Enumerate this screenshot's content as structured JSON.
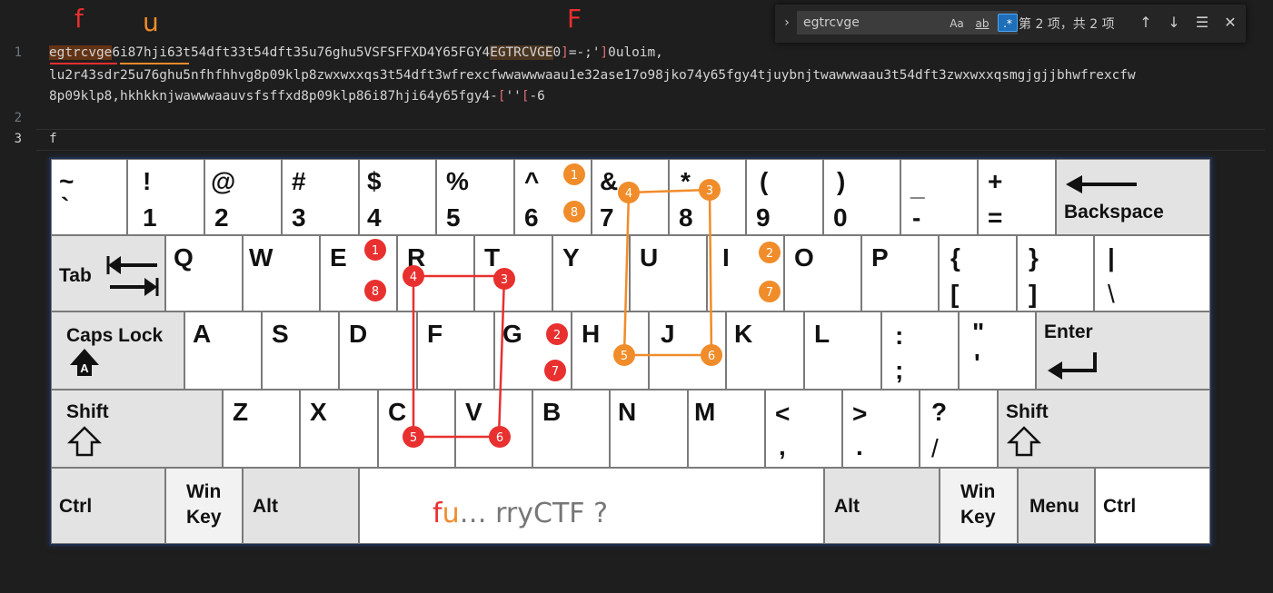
{
  "editor": {
    "line_numbers": [
      "1",
      "2",
      "3"
    ],
    "line1": {
      "match1": "egtrcvge",
      "seg_u": "6i87hji6",
      "mid": "3t54dft33t54dft35u76ghu5VSFSFFXD4Y65FGY4",
      "match2": "EGTRCVGE",
      "after_match2": "0",
      "b1": "]",
      "mid2": "=-;'",
      "b2": "]",
      "end": "0uloim,"
    },
    "line1_wrap2": "lu2r43sdr25u76ghu5nfhfhhvg8p09klp8zwxwxxqs3t54dft3wfrexcfwwawwwaau1e32ase17o98jko74y65fgy4tjuybnjtwawwwaau3t54dft3zwxwxxqsmgjgjjbhwfrexcfw",
    "line1_wrap3": {
      "text": "8p09klp8,hkhkknjwawwwaauvsfsffxd8p09klp86i87hji64y65fgy4-",
      "b1": "[",
      "mid": "''",
      "b2": "[",
      "end": "-6"
    },
    "line3": "f",
    "annotations": {
      "f_lower": "f",
      "u_lower": "u",
      "f_upper": "F"
    },
    "colors": {
      "red": "#e8302f",
      "orange": "#f08c2a",
      "match_bg": "#623315"
    }
  },
  "find_widget": {
    "expand_icon": "chevron-right-icon",
    "search_value": "egtrcvge",
    "options": [
      "Aa",
      "ab",
      ".*"
    ],
    "count": "第 2 项，共 2 项",
    "buttons": {
      "prev": "↑",
      "next": "↓",
      "selection": "☰",
      "close": "✕"
    }
  },
  "keyboard": {
    "row0": [
      {
        "top": "~",
        "bottom": "`"
      },
      {
        "top": "!",
        "bottom": "1"
      },
      {
        "top": "@",
        "bottom": "2"
      },
      {
        "top": "#",
        "bottom": "3"
      },
      {
        "top": "$",
        "bottom": "4"
      },
      {
        "top": "%",
        "bottom": "5"
      },
      {
        "top": "^",
        "bottom": "6"
      },
      {
        "top": "&",
        "bottom": "7"
      },
      {
        "top": "*",
        "bottom": "8"
      },
      {
        "top": "(",
        "bottom": "9"
      },
      {
        "top": ")",
        "bottom": "0"
      },
      {
        "top": "_",
        "bottom": "-"
      },
      {
        "top": "+",
        "bottom": "="
      }
    ],
    "backspace": "Backspace",
    "tab": "Tab",
    "row1": [
      "Q",
      "W",
      "E",
      "R",
      "T",
      "Y",
      "U",
      "I",
      "O",
      "P"
    ],
    "row1_sym": [
      {
        "top": "{",
        "bottom": "["
      },
      {
        "top": "}",
        "bottom": "]"
      },
      {
        "top": "|",
        "bottom": "\\"
      }
    ],
    "caps": "Caps Lock",
    "caps_icon_letter": "A",
    "row2": [
      "A",
      "S",
      "D",
      "F",
      "G",
      "H",
      "J",
      "K",
      "L"
    ],
    "row2_sym": [
      {
        "top": ":",
        "bottom": ";"
      },
      {
        "top": "\"",
        "bottom": "'"
      }
    ],
    "enter": "Enter",
    "shift": "Shift",
    "row3": [
      "Z",
      "X",
      "C",
      "V",
      "B",
      "N",
      "M"
    ],
    "row3_sym": [
      {
        "top": "<",
        "bottom": ","
      },
      {
        "top": ">",
        "bottom": "."
      },
      {
        "top": "?",
        "bottom": "/"
      }
    ],
    "bottom": {
      "ctrl": "Ctrl",
      "win1": "Win",
      "win2": "Key",
      "alt": "Alt",
      "menu": "Menu"
    },
    "space_text": {
      "f": "f",
      "u": "u",
      "rest": "… rryCTF ?"
    }
  },
  "markers_red": [
    "1",
    "2",
    "3",
    "4",
    "5",
    "6",
    "7",
    "8"
  ],
  "markers_orange": [
    "1",
    "2",
    "3",
    "4",
    "5",
    "6",
    "7",
    "8"
  ]
}
